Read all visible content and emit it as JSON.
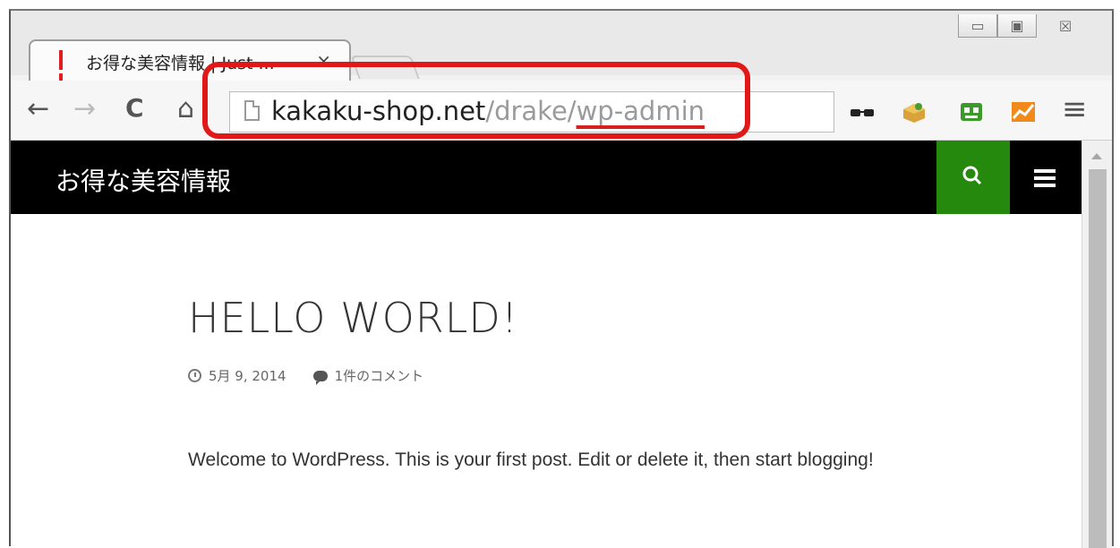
{
  "browser": {
    "tab_title": "お得な美容情報 | Just ...",
    "tab_close": "×",
    "url_host": "kakaku-shop.net",
    "url_path": "/drake/",
    "url_wp": "wp-admin",
    "window_min": "▭",
    "window_max": "▣",
    "window_close": "☒"
  },
  "nav": {
    "back": "←",
    "forward": "→",
    "reload": "C",
    "home": "⌂",
    "menu": "≡"
  },
  "site": {
    "title": "お得な美容情報"
  },
  "post": {
    "title": "HELLO WORLD!",
    "date": "5月 9, 2014",
    "comments": "1件のコメント",
    "body": "Welcome to WordPress. This is your first post. Edit or delete it, then start blogging!"
  },
  "colors": {
    "highlight": "#e01818",
    "search_bg": "#24890d",
    "header_bg": "#000000"
  }
}
